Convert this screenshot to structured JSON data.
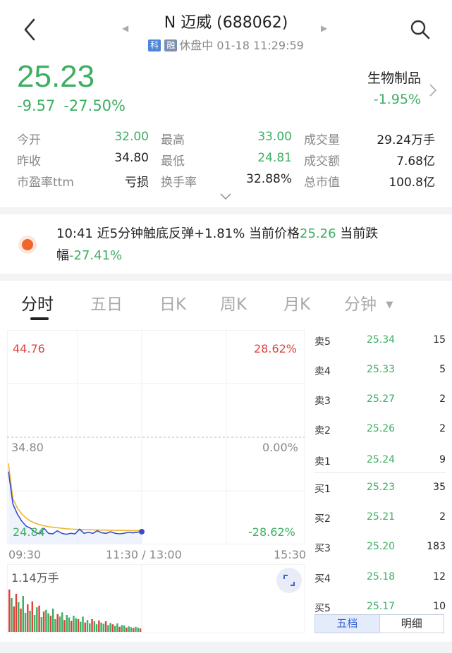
{
  "header": {
    "title": "N 迈威 (688062)",
    "badge_ke": "科",
    "badge_rong": "融",
    "status": "休盘中 01-18 11:29:59",
    "prev_arrow": "◀",
    "next_arrow": "▶"
  },
  "quote": {
    "price": "25.23",
    "change": "-9.57",
    "change_pct": "-27.50%",
    "sector": "生物制品",
    "sector_pct": "-1.95%"
  },
  "stats": [
    {
      "label": "今开",
      "value": "32.00",
      "color": "green"
    },
    {
      "label": "最高",
      "value": "33.00",
      "color": "green"
    },
    {
      "label": "成交量",
      "value": "29.24万手",
      "color": "black"
    },
    {
      "label": "昨收",
      "value": "34.80",
      "color": "black"
    },
    {
      "label": "最低",
      "value": "24.81",
      "color": "green"
    },
    {
      "label": "成交额",
      "value": "7.68亿",
      "color": "black"
    },
    {
      "label": "市盈率ttm",
      "value": "亏损",
      "color": "black"
    },
    {
      "label": "换手率",
      "value": "32.88%",
      "color": "black"
    },
    {
      "label": "总市值",
      "value": "100.8亿",
      "color": "black"
    }
  ],
  "alert": {
    "prefix": "10:41 近5分钟触底反弹+1.81% 当前价格",
    "price": "25.26",
    "mid": " 当前跌幅",
    "pct": "-27.41%"
  },
  "tabs": [
    "分时",
    "五日",
    "日K",
    "周K",
    "月K",
    "分钟"
  ],
  "chart": {
    "top_left": "44.76",
    "top_right": "28.62%",
    "mid_left": "34.80",
    "mid_right": "0.00%",
    "bottom_left": "24.84",
    "bottom_right": "-28.62%",
    "time_start": "09:30",
    "time_mid": "11:30 / 13:00",
    "time_end": "15:30",
    "volume_label": "1.14万手"
  },
  "chart_data": {
    "type": "line",
    "ylim": [
      24.84,
      44.76
    ],
    "prev_close": 34.8,
    "series": [
      {
        "values": [
          32.0,
          28.5,
          27.6,
          27.0,
          26.6,
          26.3,
          26.1,
          25.95,
          25.85,
          25.75,
          25.7,
          25.65,
          25.6,
          25.55,
          25.52,
          25.5,
          25.48,
          25.46,
          25.45,
          25.44,
          25.43,
          25.42,
          25.41,
          25.4,
          25.4,
          25.39,
          25.38,
          25.38,
          25.37,
          25.37,
          25.36
        ]
      },
      {
        "values": [
          31.2,
          28.0,
          27.0,
          26.3,
          25.8,
          25.6,
          25.2,
          25.05,
          25.6,
          25.1,
          25.05,
          25.35,
          25.1,
          25.0,
          25.1,
          25.05,
          25.5,
          25.1,
          25.2,
          25.1,
          25.35,
          25.15,
          25.1,
          25.25,
          25.1,
          25.05,
          25.1,
          25.2,
          25.15,
          25.2,
          25.26
        ]
      }
    ],
    "volume": [
      100,
      80,
      60,
      90,
      70,
      55,
      85,
      45,
      65,
      50,
      72,
      40,
      58,
      62,
      35,
      48,
      52,
      44,
      38,
      55,
      30,
      42,
      36,
      46,
      28,
      40,
      34,
      26,
      38,
      32,
      30,
      24,
      36,
      22,
      28,
      20,
      30,
      25,
      18,
      27,
      22,
      19,
      25,
      16,
      21,
      18,
      14,
      20,
      12,
      16,
      15,
      10,
      13,
      11,
      9,
      12,
      10,
      8
    ],
    "volume_up": [
      0,
      2,
      3,
      5,
      8,
      10,
      13,
      15,
      18,
      21,
      24,
      27,
      30,
      33,
      36,
      39,
      42,
      45,
      48,
      51,
      54,
      57
    ]
  },
  "orderbook": [
    {
      "label": "卖5",
      "price": "25.34",
      "qty": "15"
    },
    {
      "label": "卖4",
      "price": "25.33",
      "qty": "5"
    },
    {
      "label": "卖3",
      "price": "25.27",
      "qty": "2"
    },
    {
      "label": "卖2",
      "price": "25.26",
      "qty": "2"
    },
    {
      "label": "卖1",
      "price": "25.24",
      "qty": "9"
    },
    {
      "label": "买1",
      "price": "25.23",
      "qty": "35"
    },
    {
      "label": "买2",
      "price": "25.21",
      "qty": "2"
    },
    {
      "label": "买3",
      "price": "25.20",
      "qty": "183"
    },
    {
      "label": "买4",
      "price": "25.18",
      "qty": "12"
    },
    {
      "label": "买5",
      "price": "25.17",
      "qty": "10"
    }
  ],
  "orderbook_tabs": [
    "五档",
    "明细"
  ],
  "colors": {
    "down": "#3daf63",
    "up": "#e0413a",
    "price_line": "#3650c8",
    "avg_line": "#f0b429"
  }
}
